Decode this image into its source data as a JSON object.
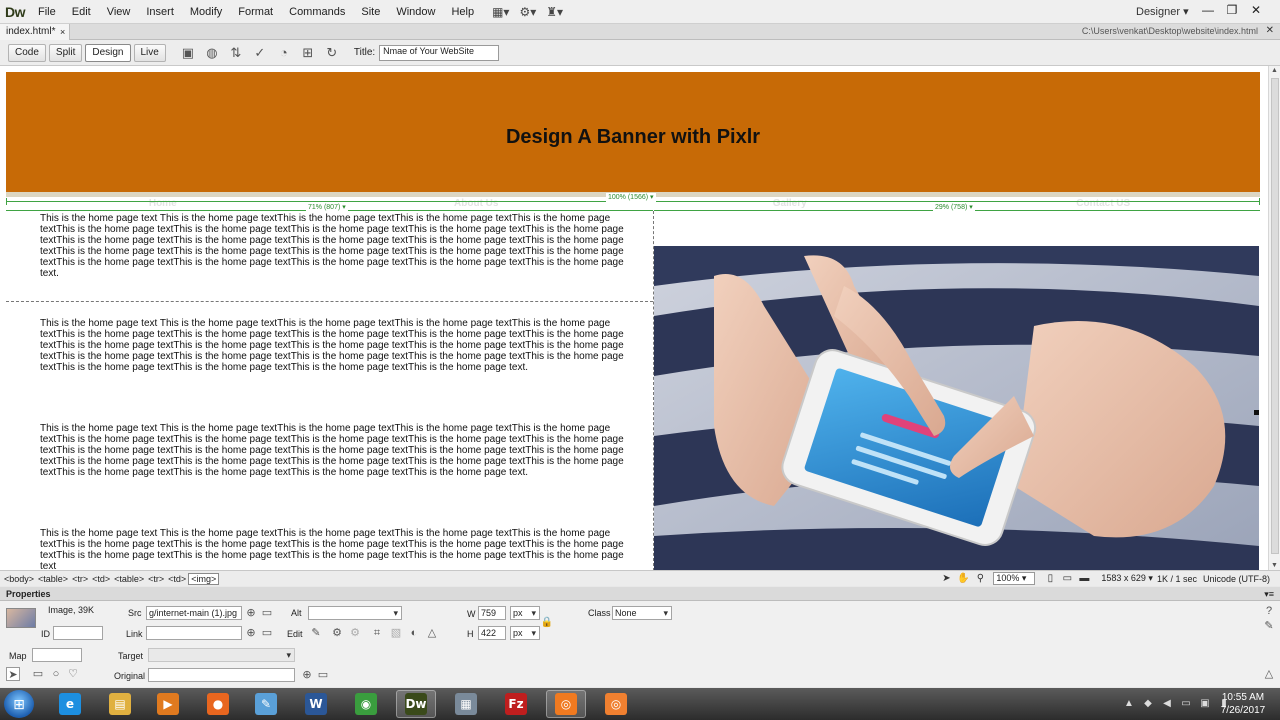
{
  "app": {
    "logo": "Dw",
    "menu": [
      "File",
      "Edit",
      "View",
      "Insert",
      "Modify",
      "Format",
      "Commands",
      "Site",
      "Window",
      "Help"
    ],
    "workspace": "Designer"
  },
  "tabs": {
    "document": "index.html*",
    "close": "×",
    "path": "C:\\Users\\venkat\\Desktop\\website\\index.html"
  },
  "doc_toolbar": {
    "views": [
      "Code",
      "Split",
      "Design",
      "Live"
    ],
    "active_view": "Design",
    "title_label": "Title:",
    "title_value": "Nmae of Your WebSite"
  },
  "page": {
    "banner_title": "Design A Banner with Pixlr",
    "nav": [
      "Home",
      "About Us",
      "Gallery",
      "Contact US"
    ],
    "guides": {
      "full": "100% (1566) ▾",
      "left": "71% (807) ▾",
      "right": "29% (758) ▾"
    },
    "paragraphs": [
      "This is the home page text This is the home page textThis is the home page textThis is the home page textThis is the home page textThis is the home page textThis is the home page textThis is the home page textThis is the home page textThis is the home page textThis is the home page textThis is the home page textThis is the home page textThis is the home page textThis is the home page textThis is the home page textThis is the home page textThis is the home page textThis is the home page textThis is the home page textThis is the home page textThis is the home page textThis is the home page textThis is the home page textThis is the home page text.",
      "This is the home page text This is the home page textThis is the home page textThis is the home page textThis is the home page textThis is the home page textThis is the home page textThis is the home page textThis is the home page textThis is the home page textThis is the home page textThis is the home page textThis is the home page textThis is the home page textThis is the home page textThis is the home page textThis is the home page textThis is the home page textThis is the home page textThis is the home page textThis is the home page textThis is the home page textThis is the home page textThis is the home page text.",
      "This is the home page text This is the home page textThis is the home page textThis is the home page textThis is the home page textThis is the home page textThis is the home page textThis is the home page textThis is the home page textThis is the home page textThis is the home page textThis is the home page textThis is the home page textThis is the home page textThis is the home page textThis is the home page textThis is the home page textThis is the home page textThis is the home page textThis is the home page textThis is the home page textThis is the home page textThis is the home page textThis is the home page text.",
      "This is the home page text This is the home page textThis is the home page textThis is the home page textThis is the home page textThis is the home page textThis is the home page textThis is the home page textThis is the home page textThis is the home page textThis is the home page textThis is the home page textThis is the home page textThis is the home page textThis is the home page text"
    ]
  },
  "statusbar": {
    "tags": [
      "<body>",
      "<table>",
      "<tr>",
      "<td>",
      "<table>",
      "<tr>",
      "<td>",
      "<img>"
    ],
    "selected_tag": "<img>",
    "zoom": "100%",
    "size": "1583 x 629 ▾",
    "download": "1K / 1 sec",
    "encoding": "Unicode (UTF-8)"
  },
  "properties": {
    "title": "Properties",
    "type": "Image, 39K",
    "id_label": "ID",
    "id_value": "",
    "src_label": "Src",
    "src_value": "g/internet-main (1).jpg",
    "link_label": "Link",
    "link_value": "",
    "alt_label": "Alt",
    "alt_value": "",
    "edit_label": "Edit",
    "w_label": "W",
    "w_value": "759",
    "h_label": "H",
    "h_value": "422",
    "unit": "px",
    "class_label": "Class",
    "class_value": "None",
    "map_label": "Map",
    "map_value": "",
    "target_label": "Target",
    "target_value": "",
    "original_label": "Original",
    "original_value": ""
  },
  "taskbar": {
    "apps": [
      {
        "name": "internet-explorer",
        "glyph": "e",
        "color": "#1d8fe0"
      },
      {
        "name": "file-explorer",
        "glyph": "▤",
        "color": "#e0b040"
      },
      {
        "name": "media-player",
        "glyph": "▶",
        "color": "#e07a1f"
      },
      {
        "name": "firefox",
        "glyph": "●",
        "color": "#e8661f"
      },
      {
        "name": "notepad",
        "glyph": "✎",
        "color": "#5aa0d8"
      },
      {
        "name": "word",
        "glyph": "W",
        "color": "#2b5797"
      },
      {
        "name": "chrome",
        "glyph": "◉",
        "color": "#3a9d3e"
      },
      {
        "name": "dreamweaver",
        "glyph": "Dw",
        "color": "#3a4a1a"
      },
      {
        "name": "calculator",
        "glyph": "▦",
        "color": "#7a8a9a"
      },
      {
        "name": "filezilla",
        "glyph": "Fz",
        "color": "#bf1e1e"
      },
      {
        "name": "pixlr",
        "glyph": "◎",
        "color": "#f07a20"
      },
      {
        "name": "pixlr-editor",
        "glyph": "◎",
        "color": "#f08030"
      }
    ],
    "time": "10:55 AM",
    "date": "7/26/2017"
  }
}
